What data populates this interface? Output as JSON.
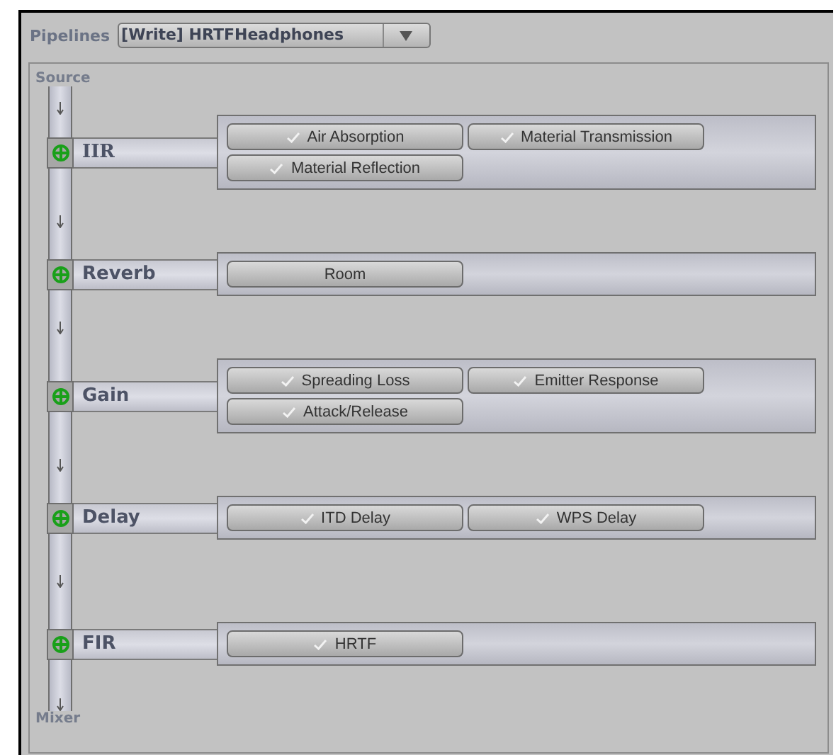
{
  "pipelines_label": "Pipelines",
  "pipeline_select": {
    "value": "[Write] HRTFHeadphones"
  },
  "source_label": "Source",
  "stages": [
    {
      "name": "IIR",
      "effects": [
        {
          "label": "Air Absorption",
          "checked": true
        },
        {
          "label": "Material Transmission",
          "checked": true
        },
        {
          "label": "Material Reflection",
          "checked": true
        }
      ]
    },
    {
      "name": "Reverb",
      "effects": [
        {
          "label": "Room",
          "checked": false
        }
      ]
    },
    {
      "name": "Gain",
      "effects": [
        {
          "label": "Spreading Loss",
          "checked": true
        },
        {
          "label": "Emitter Response",
          "checked": true
        },
        {
          "label": "Attack/Release",
          "checked": true
        }
      ]
    },
    {
      "name": "Delay",
      "effects": [
        {
          "label": "ITD Delay",
          "checked": true
        },
        {
          "label": "WPS Delay",
          "checked": true
        }
      ]
    },
    {
      "name": "FIR",
      "effects": [
        {
          "label": "HRTF",
          "checked": true
        }
      ]
    }
  ],
  "mixer_label": "Mixer"
}
